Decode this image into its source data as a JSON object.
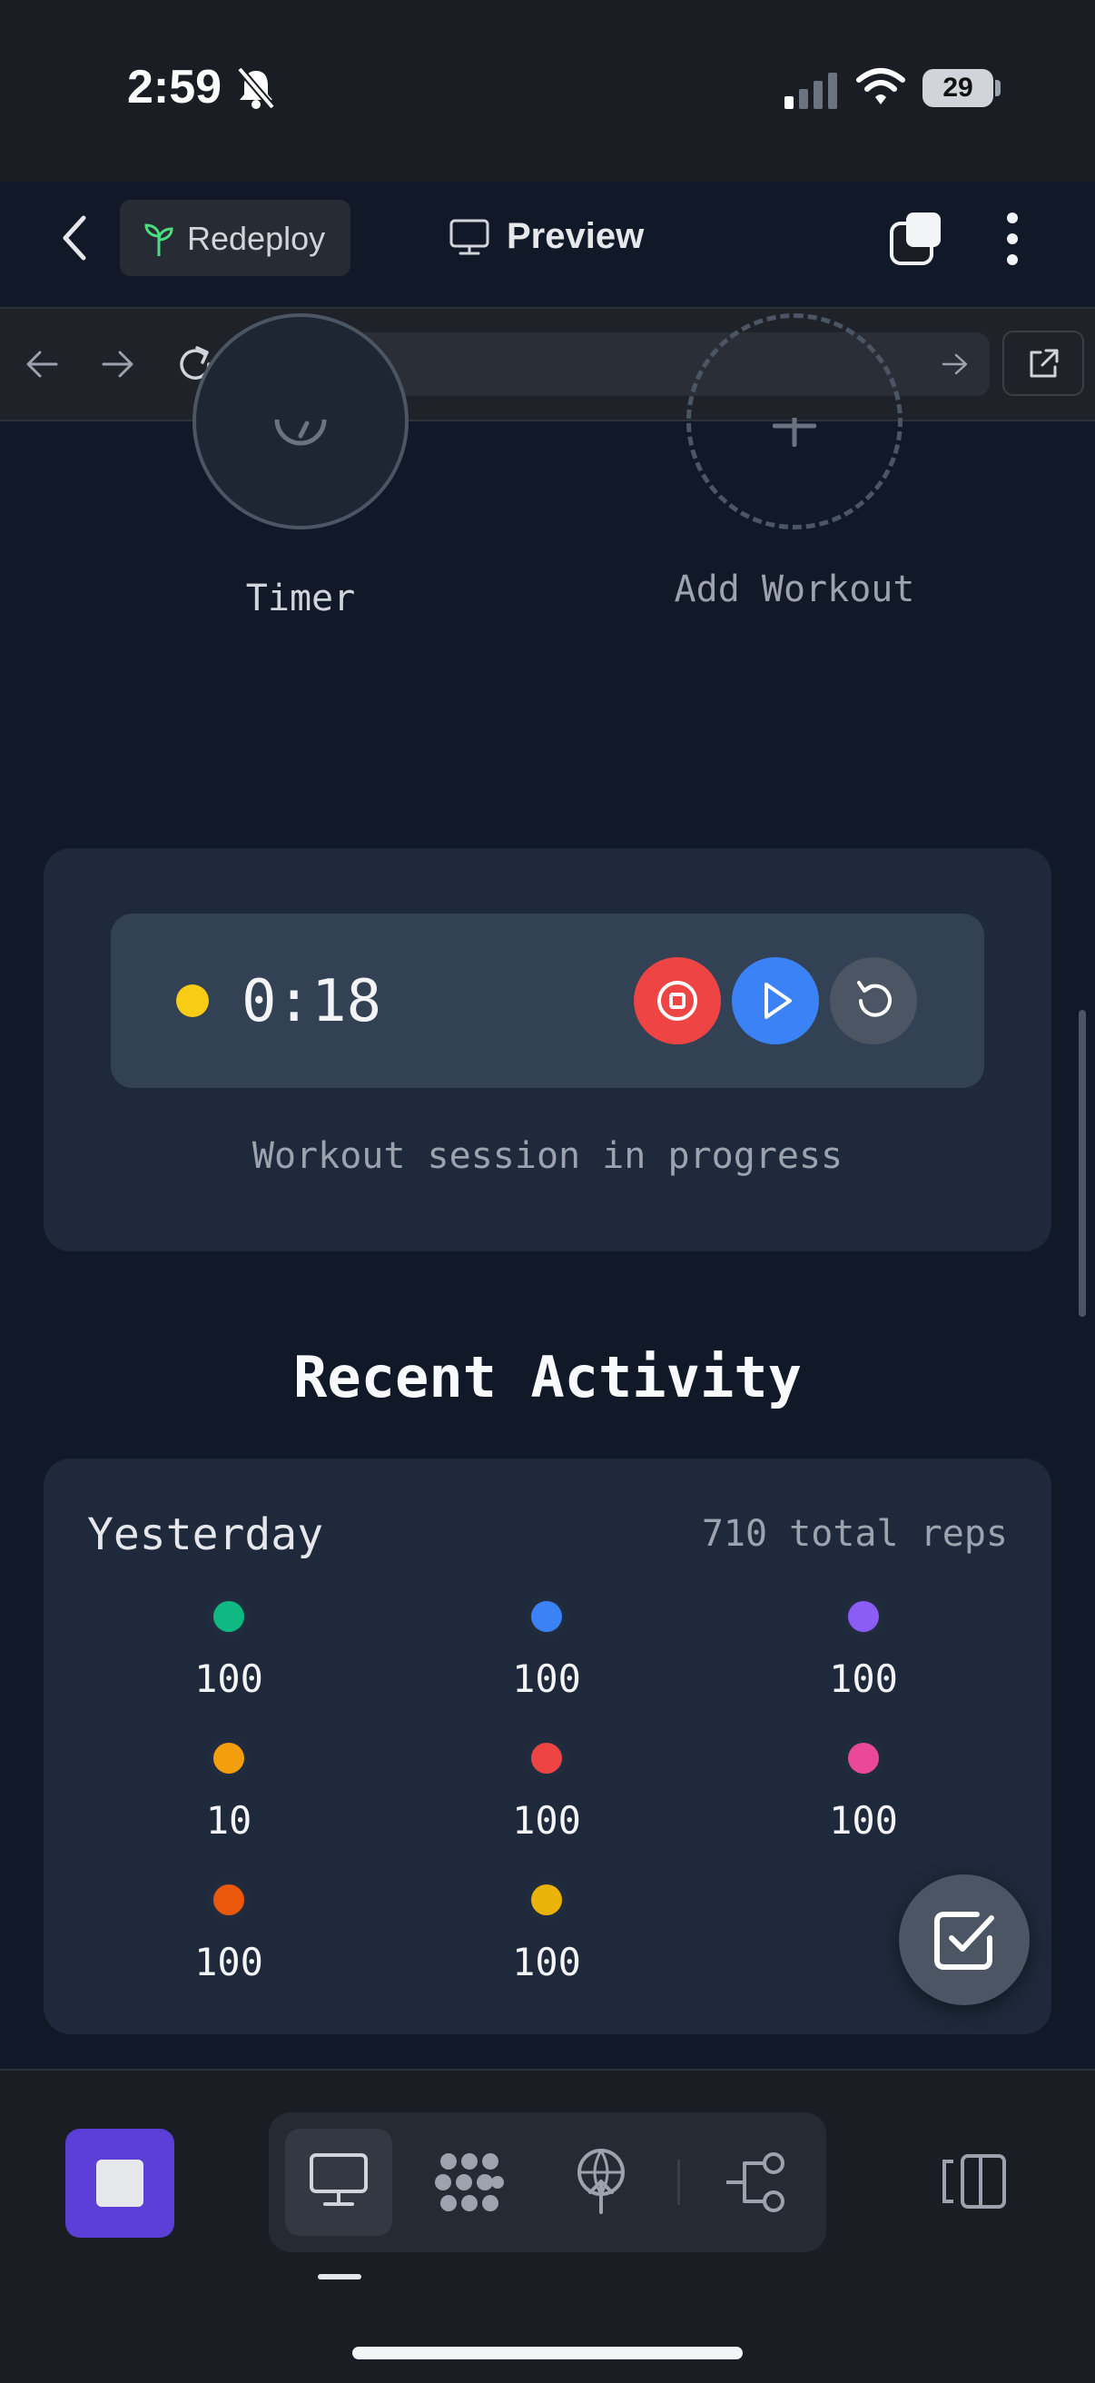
{
  "status_bar": {
    "time": "2:59",
    "battery": "29"
  },
  "header": {
    "redeploy_label": "Redeploy",
    "preview_label": "Preview"
  },
  "browser": {
    "url": "/"
  },
  "shortcuts": {
    "timer_label": "Timer",
    "add_workout_label": "Add Workout"
  },
  "session": {
    "elapsed": "0:18",
    "status": "Workout session in progress"
  },
  "activity": {
    "title": "Recent Activity",
    "day": "Yesterday",
    "total": "710 total reps",
    "entries": [
      {
        "value": "100",
        "color": "#10b981"
      },
      {
        "value": "100",
        "color": "#3b82f6"
      },
      {
        "value": "100",
        "color": "#8b5cf6"
      },
      {
        "value": "10",
        "color": "#f59e0b"
      },
      {
        "value": "100",
        "color": "#ef4444"
      },
      {
        "value": "100",
        "color": "#ec4899"
      },
      {
        "value": "100",
        "color": "#ea580c"
      },
      {
        "value": "100",
        "color": "#eab308"
      }
    ]
  },
  "icons": {
    "bell": "bell-slash-icon",
    "signal": "cellular-signal-icon",
    "wifi": "wifi-icon",
    "back": "chevron-left-icon",
    "plant": "plant-icon",
    "monitor": "monitor-icon",
    "tabs": "tabs-icon",
    "more": "more-vertical-icon",
    "nav_back": "arrow-left-icon",
    "nav_forward": "arrow-right-icon",
    "reload": "reload-icon",
    "go": "arrow-right-icon",
    "external": "external-link-icon",
    "stopwatch": "stopwatch-icon",
    "plus": "plus-icon",
    "stop": "stop-icon",
    "play": "play-icon",
    "reset": "reset-icon",
    "check": "checkbox-icon",
    "desktop": "desktop-icon",
    "agents": "agents-icon",
    "deploy": "deploy-icon",
    "workflow": "workflow-icon",
    "panels": "split-panel-icon"
  },
  "theme": {
    "background": "#111827",
    "card": "#1e293b",
    "accent_purple": "#5b3fd6",
    "stop_red": "#ef4444",
    "play_blue": "#3b82f6",
    "active_dot": "#facc15"
  }
}
